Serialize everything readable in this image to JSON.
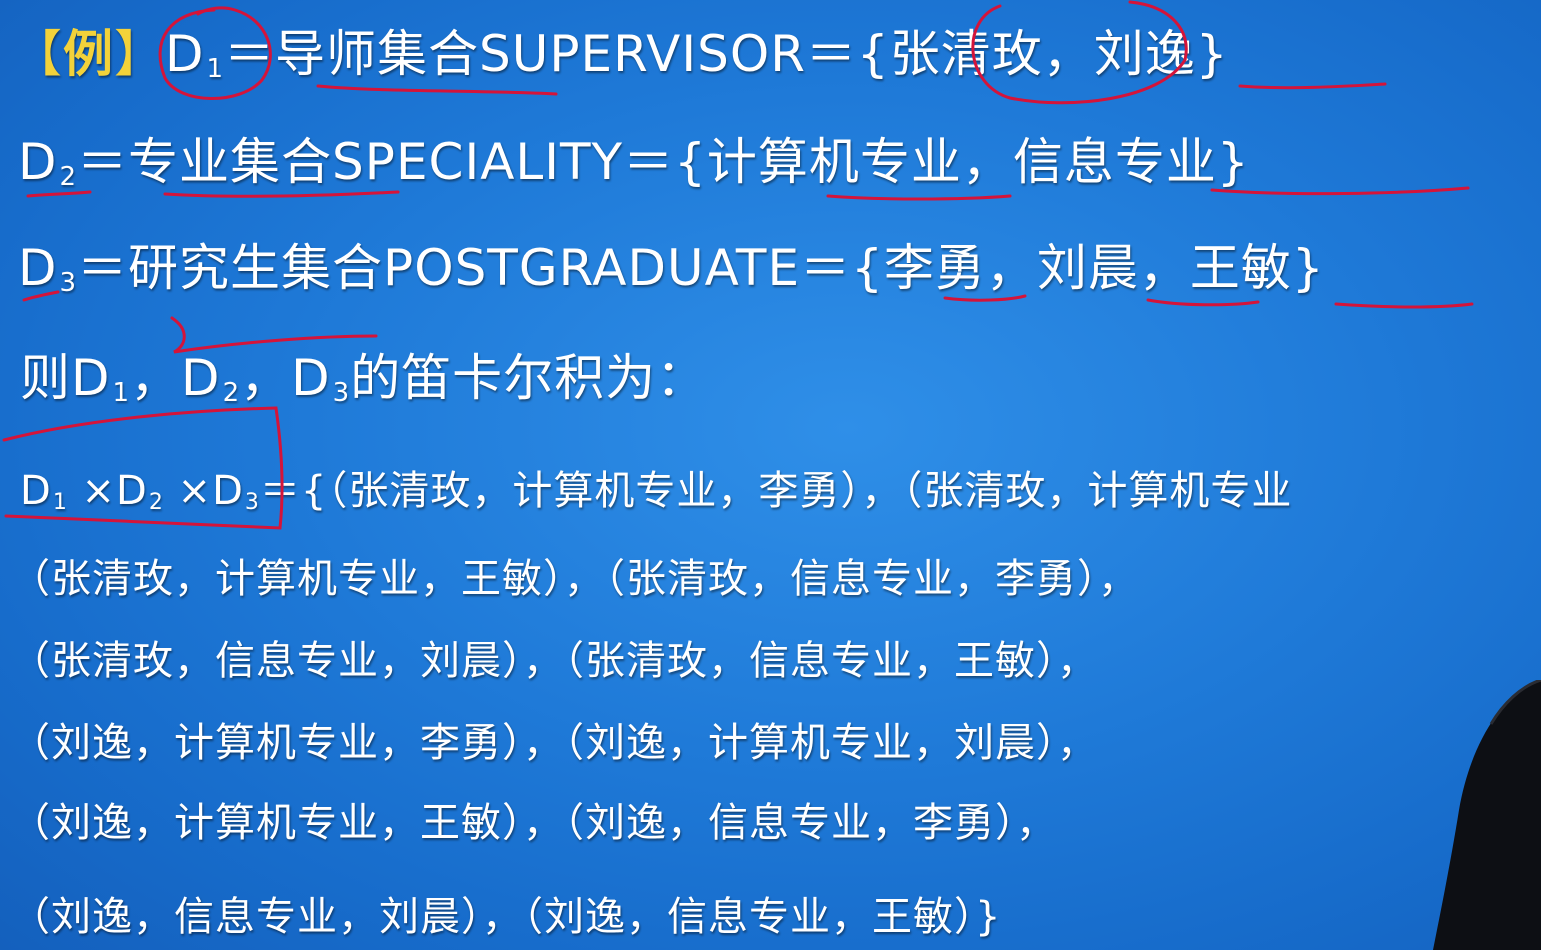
{
  "line1": {
    "bracket_left": "【",
    "tag": "例",
    "bracket_right": "】",
    "d": "D",
    "sub": "1",
    "rest": "＝导师集合SUPERVISOR＝{张清玫，刘逸}"
  },
  "line2": {
    "d": "D",
    "sub": "2",
    "rest": "＝专业集合SPECIALITY＝{计算机专业，信息专业}"
  },
  "line3": {
    "d": "D",
    "sub": "3",
    "rest": "＝研究生集合POSTGRADUATE＝{李勇，刘晨，王敏}"
  },
  "line4": {
    "prefix": "则D",
    "sub1": "1",
    "sep1": "，D",
    "sub2": "2",
    "sep2": "，D",
    "sub3": "3",
    "rest": "的笛卡尔积为："
  },
  "line5": {
    "d1": "D",
    "sub1": "1",
    "x1": " ×D",
    "sub2": "2",
    "x2": " ×D",
    "sub3": "3",
    "rest": "＝{（张清玫，计算机专业，李勇），（张清玫，计算机专业"
  },
  "tuples": [
    "（张清玫，计算机专业，王敏），（张清玫，信息专业，李勇），",
    "（张清玫，信息专业，刘晨），（张清玫，信息专业，王敏），",
    "（刘逸，计算机专业，李勇），（刘逸，计算机专业，刘晨），",
    "（刘逸，计算机专业，王敏），（刘逸，信息专业，李勇），",
    "（刘逸，信息专业，刘晨），（刘逸，信息专业，王敏）}"
  ],
  "colors": {
    "background": "#1f7ad8",
    "text": "#ffffff",
    "tag": "#f3d23a",
    "annotation": "#d4143a"
  }
}
